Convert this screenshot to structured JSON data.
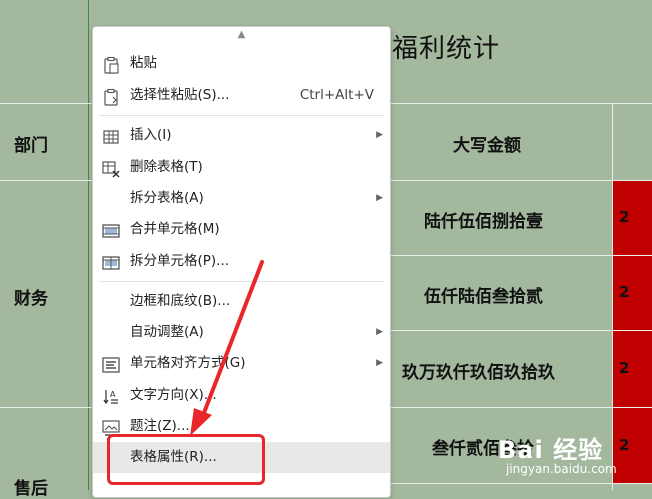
{
  "document": {
    "title": "福利统计",
    "headers": {
      "dept": "部门",
      "amount_upper": "大写金额"
    },
    "departments": [
      "财务",
      "售后"
    ],
    "amounts": [
      "陆仟伍佰捌拾壹",
      "伍仟陆佰叁拾贰",
      "玖万玖仟玖佰玖拾玖",
      "叁仟贰佰叁拾"
    ],
    "red_cells": [
      "2",
      "2",
      "2",
      "2"
    ]
  },
  "menu": {
    "items": [
      {
        "label": "粘贴",
        "icon": "paste-icon"
      },
      {
        "label": "选择性粘贴(S)...",
        "shortcut": "Ctrl+Alt+V",
        "icon": "paste-special-icon"
      },
      {
        "label": "插入(I)",
        "icon": "table-insert-icon",
        "submenu": true
      },
      {
        "label": "删除表格(T)",
        "icon": "table-delete-icon"
      },
      {
        "label": "拆分表格(A)",
        "submenu": true
      },
      {
        "label": "合并单元格(M)",
        "icon": "merge-cells-icon"
      },
      {
        "label": "拆分单元格(P)...",
        "icon": "split-cells-icon"
      },
      {
        "label": "边框和底纹(B)..."
      },
      {
        "label": "自动调整(A)",
        "submenu": true
      },
      {
        "label": "单元格对齐方式(G)",
        "icon": "align-icon",
        "submenu": true
      },
      {
        "label": "文字方向(X)...",
        "icon": "text-direction-icon"
      },
      {
        "label": "题注(Z)...",
        "icon": "caption-icon"
      },
      {
        "label": "表格属性(R)..."
      }
    ]
  },
  "watermark": {
    "logo": "Bai 经验",
    "url": "jingyan.baidu.com"
  },
  "colors": {
    "background": "#a3b89d",
    "highlight": "#e8262b",
    "red_cell": "#c00000"
  }
}
